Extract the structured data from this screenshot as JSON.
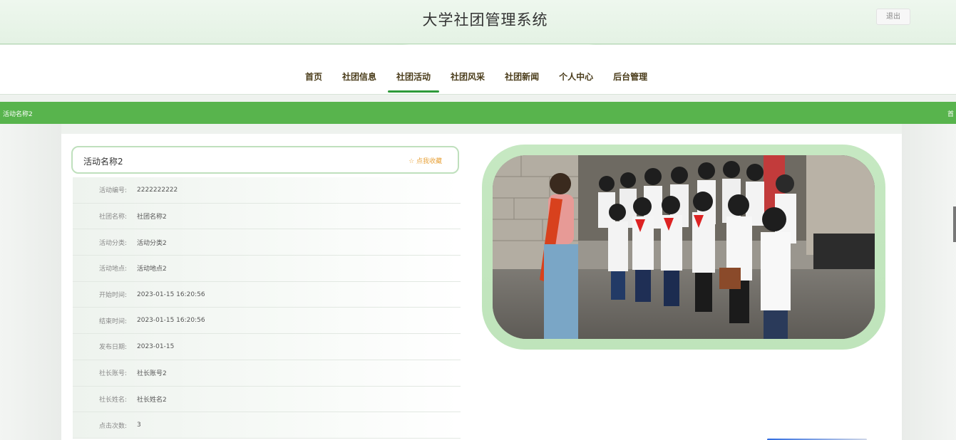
{
  "header": {
    "title": "大学社团管理系统",
    "logout_label": "退出"
  },
  "nav": {
    "items": [
      {
        "label": "首页"
      },
      {
        "label": "社团信息"
      },
      {
        "label": "社团活动"
      },
      {
        "label": "社团风采"
      },
      {
        "label": "社团新闻"
      },
      {
        "label": "个人中心"
      },
      {
        "label": "后台管理"
      }
    ],
    "active_index": 2
  },
  "breadcrumb": {
    "current": "活动名称2",
    "home": "首"
  },
  "detail": {
    "title": "活动名称2",
    "favorite_label": "☆ 点我收藏",
    "fields": [
      {
        "label": "活动编号:",
        "value": "2222222222"
      },
      {
        "label": "社团名称:",
        "value": "社团名称2"
      },
      {
        "label": "活动分类:",
        "value": "活动分类2"
      },
      {
        "label": "活动地点:",
        "value": "活动地点2"
      },
      {
        "label": "开始时间:",
        "value": "2023-01-15 16:20:56"
      },
      {
        "label": "结束时间:",
        "value": "2023-01-15 16:20:56"
      },
      {
        "label": "发布日期:",
        "value": "2023-01-15"
      },
      {
        "label": "社长账号:",
        "value": "社长账号2"
      },
      {
        "label": "社长姓名:",
        "value": "社长姓名2"
      },
      {
        "label": "点击次数:",
        "value": "3"
      }
    ]
  },
  "colors": {
    "accent": "#58b44d",
    "nav_text": "#4a3c1a",
    "frame": "#bfe4bb",
    "favorite": "#e8a33c"
  }
}
